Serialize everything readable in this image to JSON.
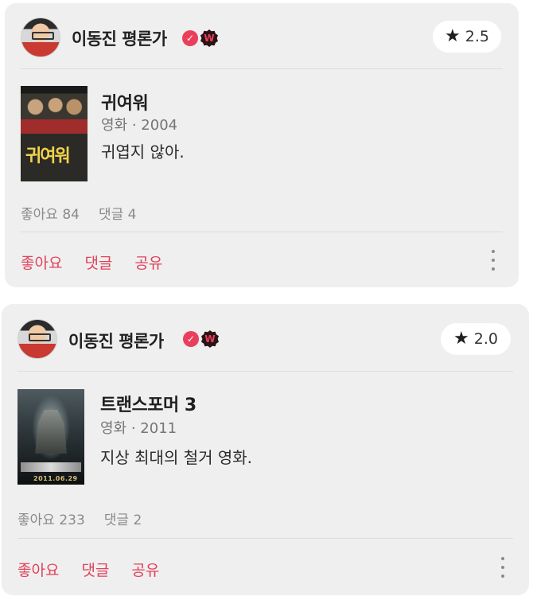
{
  "reviews": [
    {
      "user": {
        "name": "이동진 평론가",
        "verified_icon": "check-badge-icon",
        "badge_icon": "watcha-w-badge-icon",
        "badge_letter": "W"
      },
      "rating": "2.5",
      "movie": {
        "title": "귀여워",
        "meta": "영화 · 2004",
        "poster_title": "귀여워"
      },
      "comment": "귀엽지 않아.",
      "stats": {
        "likes": "좋아요 84",
        "comments": "댓글 4"
      },
      "actions": {
        "like": "좋아요",
        "comment": "댓글",
        "share": "공유"
      }
    },
    {
      "user": {
        "name": "이동진 평론가",
        "verified_icon": "check-badge-icon",
        "badge_icon": "watcha-w-badge-icon",
        "badge_letter": "W"
      },
      "rating": "2.0",
      "movie": {
        "title": "트랜스포머 3",
        "meta": "영화 · 2011",
        "poster_date": "2011.06.29"
      },
      "comment": "지상 최대의 철거 영화.",
      "stats": {
        "likes": "좋아요 233",
        "comments": "댓글 2"
      },
      "actions": {
        "like": "좋아요",
        "comment": "댓글",
        "share": "공유"
      }
    }
  ],
  "colors": {
    "accent": "#e0425a",
    "card": "#efefef",
    "muted": "#8a8a8a"
  }
}
